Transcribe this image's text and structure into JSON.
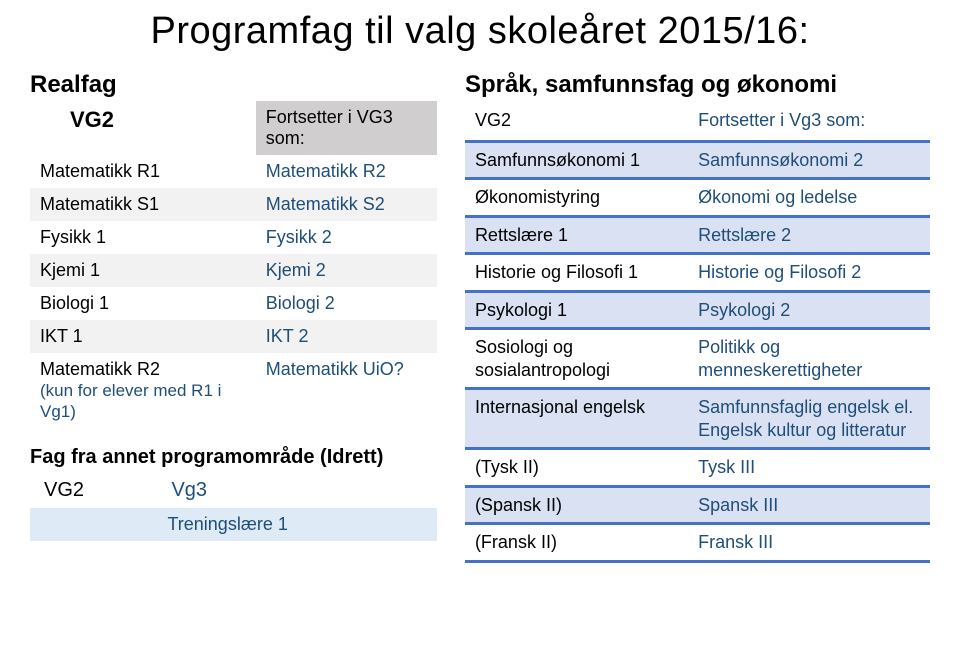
{
  "title": "Programfag til valg skoleåret 2015/16:",
  "realfag": {
    "heading": "Realfag",
    "col1_header": "VG2",
    "col2_header": "Fortsetter i VG3 som:",
    "rows": [
      {
        "c1": "Matematikk R1",
        "c2": "Matematikk R2"
      },
      {
        "c1": "Matematikk S1",
        "c2": "Matematikk S2"
      },
      {
        "c1": "Fysikk 1",
        "c2": "Fysikk 2"
      },
      {
        "c1": "Kjemi 1",
        "c2": "Kjemi 2"
      },
      {
        "c1": "Biologi 1",
        "c2": "Biologi 2"
      },
      {
        "c1": "IKT 1",
        "c2": "IKT 2"
      },
      {
        "c1": "Matematikk R2",
        "c1sub": "(kun for elever med R1 i Vg1)",
        "c2": "Matematikk UiO?"
      }
    ]
  },
  "idrett": {
    "heading": "Fag fra annet programområde (Idrett)",
    "col1_header": "VG2",
    "col2_header": "Vg3",
    "row": {
      "c1": "",
      "c2": "Treningslære 1"
    }
  },
  "sprak": {
    "heading": "Språk, samfunnsfag og økonomi",
    "col1_header": "VG2",
    "col2_header": "Fortsetter i Vg3 som:",
    "rows": [
      {
        "c1": "Samfunnsøkonomi 1",
        "c2": "Samfunnsøkonomi 2"
      },
      {
        "c1": "Økonomistyring",
        "c2": "Økonomi og ledelse"
      },
      {
        "c1": "Rettslære 1",
        "c2": "Rettslære 2"
      },
      {
        "c1": "Historie og Filosofi 1",
        "c2": "Historie og Filosofi 2"
      },
      {
        "c1": "Psykologi 1",
        "c2": "Psykologi 2"
      },
      {
        "c1": "Sosiologi og sosialantropologi",
        "c2": "Politikk og menneskerettigheter"
      },
      {
        "c1": "Internasjonal engelsk",
        "c2": "Samfunnsfaglig engelsk el. Engelsk kultur og litteratur"
      },
      {
        "c1": "(Tysk II)",
        "c2": "Tysk III",
        "muted": true
      },
      {
        "c1": "(Spansk II)",
        "c2": "Spansk III",
        "muted": true
      },
      {
        "c1": "(Fransk II)",
        "c2": "Fransk III",
        "muted": true
      }
    ]
  }
}
